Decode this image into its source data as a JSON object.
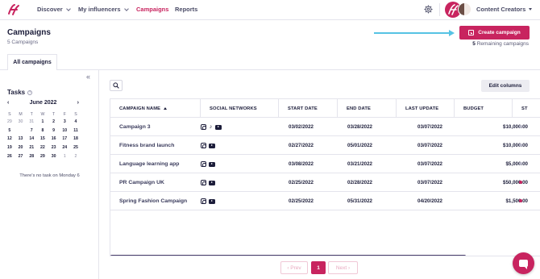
{
  "nav": {
    "items": [
      {
        "label": "Discover",
        "has_chevron": true
      },
      {
        "label": "My influencers",
        "has_chevron": true
      },
      {
        "label": "Campaigns",
        "active": true
      },
      {
        "label": "Reports"
      }
    ],
    "workspace": "Content Creators",
    "accent_color": "#c8245f"
  },
  "header": {
    "title": "Campaigns",
    "count_label": "5 Campaigns",
    "create_button": "Create campaign",
    "remaining_num": "5",
    "remaining_text": "Remaining campaigns"
  },
  "tabs": [
    {
      "label": "All campaigns",
      "active": true
    }
  ],
  "tasks": {
    "title": "Tasks",
    "month": "June 2022",
    "prev": "‹",
    "next": "›",
    "weekdays": [
      "S",
      "M",
      "T",
      "W",
      "T",
      "F",
      "S"
    ],
    "days": [
      [
        "29",
        "30",
        "31",
        "1",
        "2",
        "3",
        "4"
      ],
      [
        "5",
        "6",
        "7",
        "8",
        "9",
        "10",
        "11"
      ],
      [
        "12",
        "13",
        "14",
        "15",
        "16",
        "17",
        "18"
      ],
      [
        "19",
        "20",
        "21",
        "22",
        "23",
        "24",
        "25"
      ],
      [
        "26",
        "27",
        "28",
        "29",
        "30",
        "1",
        "2"
      ]
    ],
    "today": "6",
    "empty_message": "There's no task on Monday 6"
  },
  "toolbar": {
    "edit_columns": "Edit columns",
    "collapse": "«"
  },
  "table": {
    "columns": [
      "CAMPAIGN NAME",
      "SOCIAL NETWORKS",
      "START DATE",
      "END DATE",
      "LAST UPDATE",
      "BUDGET",
      "ST"
    ],
    "rows": [
      {
        "name": "Campaign 3",
        "networks": [
          "instagram",
          "tiktok",
          "youtube"
        ],
        "start": "03/02/2022",
        "end": "03/28/2022",
        "updated": "03/07/2022",
        "budget": "$10,000.00",
        "status": "grey"
      },
      {
        "name": "Fitness brand launch",
        "networks": [
          "instagram",
          "youtube"
        ],
        "start": "02/27/2022",
        "end": "05/01/2022",
        "updated": "03/07/2022",
        "budget": "$10,000.00",
        "status": "grey"
      },
      {
        "name": "Language learning app",
        "networks": [
          "instagram",
          "youtube"
        ],
        "start": "03/08/2022",
        "end": "03/21/2022",
        "updated": "03/07/2022",
        "budget": "$5,000.00",
        "status": "grey"
      },
      {
        "name": "PR Campaign UK",
        "networks": [
          "instagram",
          "youtube"
        ],
        "start": "02/25/2022",
        "end": "02/28/2022",
        "updated": "03/07/2022",
        "budget": "$50,000.00",
        "status": "red"
      },
      {
        "name": "Spring Fashion Campaign",
        "networks": [
          "instagram",
          "youtube"
        ],
        "start": "02/25/2022",
        "end": "05/31/2022",
        "updated": "04/20/2022",
        "budget": "$1,500.00",
        "status": "red"
      }
    ]
  },
  "pagination": {
    "prev": "‹ Prev",
    "current": "1",
    "next": "Next ›"
  }
}
